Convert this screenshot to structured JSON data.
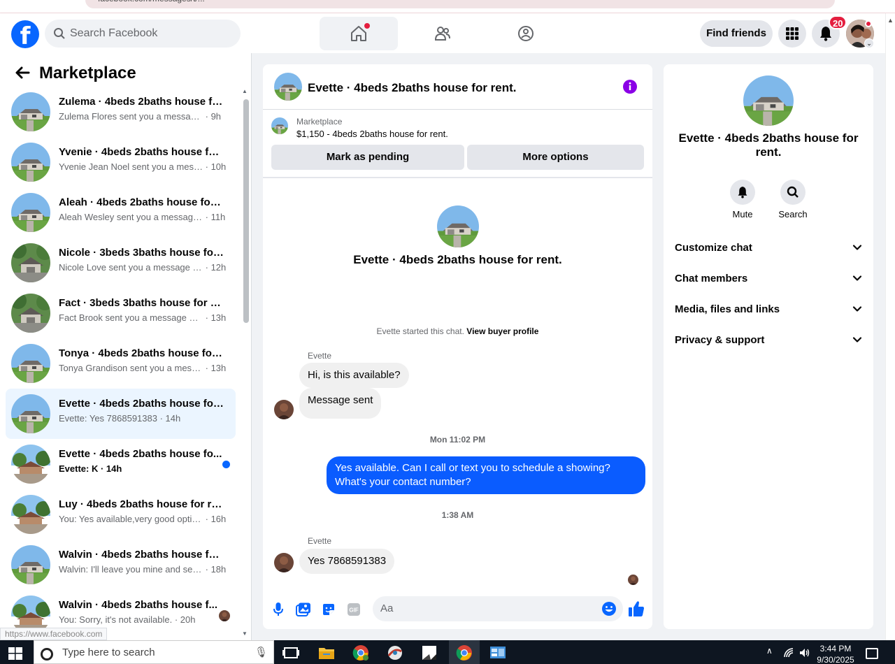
{
  "browser": {
    "url": "facebook.com/messages/t/..."
  },
  "header": {
    "search_placeholder": "Search Facebook",
    "find_friends": "Find friends",
    "notification_count": "20"
  },
  "left": {
    "title": "Marketplace",
    "conversations": [
      {
        "title": "Zulema · 4beds 2baths house fo...",
        "preview": "Zulema Flores sent you a message ...",
        "time": "· 9h",
        "state": "read"
      },
      {
        "title": "Yvenie · 4beds 2baths house for ...",
        "preview": "Yvenie Jean Noel sent you a mess...",
        "time": "· 10h",
        "state": "read"
      },
      {
        "title": "Aleah · 4beds 2baths house for r...",
        "preview": "Aleah Wesley sent you a message ...",
        "time": "· 11h",
        "state": "read"
      },
      {
        "title": "Nicole · 3beds 3baths house for ...",
        "preview": "Nicole Love sent you a message a...",
        "time": "· 12h",
        "state": "read"
      },
      {
        "title": "Fact · 3beds 3baths house for re...",
        "preview": "Fact Brook sent you a message ab...",
        "time": "· 13h",
        "state": "read"
      },
      {
        "title": "Tonya · 4beds 2baths house for ...",
        "preview": "Tonya Grandison sent you a mess...",
        "time": "· 13h",
        "state": "read"
      },
      {
        "title": "Evette · 4beds 2baths house for ...",
        "preview": "Evette: Yes 7868591383",
        "time": "· 14h",
        "state": "active"
      },
      {
        "title": "Evette · 4beds 2baths house fo...",
        "preview": "Evette: K",
        "time": "· 14h",
        "state": "unread"
      },
      {
        "title": "Luy · 4beds 2baths house for rent.",
        "preview": "You: Yes available,very good optio...",
        "time": "· 16h",
        "state": "read"
      },
      {
        "title": "Walvin · 4beds 2baths house for...",
        "preview": "Walvin: I'll leave you mine and sen...",
        "time": "· 18h",
        "state": "read"
      },
      {
        "title": "Walvin · 4beds 2baths house f...",
        "preview": "You: Sorry, it's not available.",
        "time": "· 20h",
        "state": "seen"
      }
    ],
    "status_url": "https://www.facebook.com"
  },
  "chat": {
    "title": "Evette · 4beds 2baths house for rent.",
    "marketplace_label": "Marketplace",
    "listing": "$1,150 - 4beds 2baths house for rent.",
    "mark_pending": "Mark as pending",
    "more_options": "More options",
    "intro_title": "Evette · 4beds 2baths house for rent.",
    "started_text": "Evette started this chat.",
    "view_profile": "View buyer profile",
    "sender_name_1": "Evette",
    "msg_1": "Hi, is this available?",
    "msg_2": "Message sent",
    "time_1": "Mon 11:02 PM",
    "msg_3": "Yes available. Can I call or text you to schedule a showing? What's your contact number?",
    "time_2": "1:38 AM",
    "sender_name_2": "Evette",
    "msg_4": "Yes 7868591383",
    "composer_placeholder": "Aa",
    "gif_label": "GIF"
  },
  "info": {
    "title": "Evette · 4beds 2baths house for rent.",
    "mute": "Mute",
    "search": "Search",
    "sections": [
      "Customize chat",
      "Chat members",
      "Media, files and links",
      "Privacy & support"
    ]
  },
  "taskbar": {
    "search_placeholder": "Type here to search",
    "time": "3:44 PM",
    "date": "9/30/2025"
  },
  "colors": {
    "brand": "#0866ff",
    "outgoing_bubble": "#0a5cff",
    "badge": "#e41e3f",
    "info_icon": "#8a00e6"
  }
}
